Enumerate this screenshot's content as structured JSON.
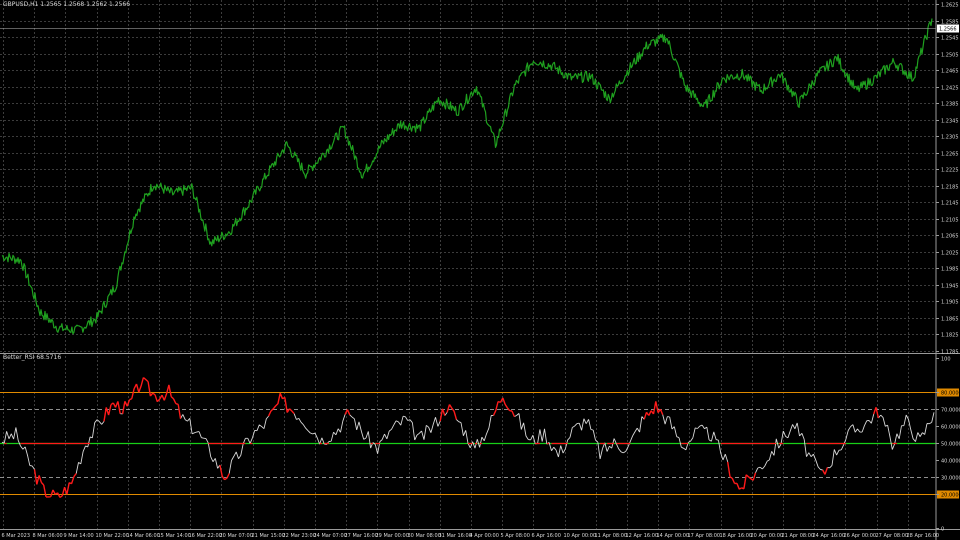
{
  "header": {
    "symbol_info": "GBPUSD,H1  1.2565 1.2568 1.2562 1.2566",
    "indicator_info": "Better_RSI 68.5716"
  },
  "colors": {
    "background": "#000000",
    "grid": "#3c3c3c",
    "axis_text": "#d8d8d8",
    "price_line": "#1fa01f",
    "rsi_line": "#d8d8d8",
    "rsi_extreme": "#ff1a1a",
    "midline": "#18d018",
    "level_extreme": "#e08a00",
    "level_inner": "#bdbdbd",
    "price_tag_bg": "#ffffff",
    "price_tag_text": "#000000"
  },
  "chart_data": [
    {
      "type": "line",
      "title": "GBPUSD,H1",
      "ylim": [
        1.1785,
        1.2625
      ],
      "y_ticks": [
        "1.2625",
        "1.2585",
        "1.2545",
        "1.2505",
        "1.2465",
        "1.2425",
        "1.2385",
        "1.2345",
        "1.2305",
        "1.2265",
        "1.2225",
        "1.2185",
        "1.2145",
        "1.2105",
        "1.2065",
        "1.2025",
        "1.1985",
        "1.1945",
        "1.1905",
        "1.1865",
        "1.1825",
        "1.1785"
      ],
      "current_price": "1.2566",
      "x": [
        "6 Mar 2023",
        "8 Mar 06:00",
        "9 Mar 14:00",
        "10 Mar 22:00",
        "14 Mar 06:00",
        "15 Mar 14:00",
        "16 Mar 22:00",
        "20 Mar 07:00",
        "21 Mar 15:00",
        "22 Mar 23:00",
        "24 Mar 07:00",
        "27 Mar 16:00",
        "29 Mar 00:00",
        "30 Mar 08:00",
        "31 Mar 16:00",
        "4 Apr 00:00",
        "5 Apr 08:00",
        "6 Apr 16:00",
        "10 Apr 00:00",
        "11 Apr 08:00",
        "12 Apr 16:00",
        "14 Apr 00:00",
        "17 Apr 08:00",
        "18 Apr 16:00",
        "20 Apr 00:00",
        "21 Apr 08:00",
        "24 Apr 16:00",
        "26 Apr 00:00",
        "27 Apr 08:00",
        "28 Apr 16:00"
      ],
      "series": [
        {
          "values": [
            1.2015,
            1.2005,
            1.188,
            1.184,
            1.1835,
            1.1865,
            1.1945,
            1.2115,
            1.219,
            1.2165,
            1.218,
            1.2045,
            1.2075,
            1.214,
            1.2215,
            1.2285,
            1.2215,
            1.2265,
            1.2325,
            1.221,
            1.2285,
            1.2335,
            1.2325,
            1.2395,
            1.2365,
            1.2425,
            1.2285,
            1.2425,
            1.249,
            1.2475,
            1.2445,
            1.245,
            1.2395,
            1.2465,
            1.2525,
            1.2545,
            1.2425,
            1.2375,
            1.2445,
            1.2455,
            1.2415,
            1.2455,
            1.2385,
            1.2455,
            1.2495,
            1.2415,
            1.2445,
            1.2485,
            1.2445,
            1.259
          ]
        }
      ]
    },
    {
      "type": "line",
      "title": "Better_RSI",
      "ylim": [
        0,
        100
      ],
      "y_ticks": [
        "100",
        "80.0000",
        "70.0000",
        "60.0000",
        "50.0000",
        "40.0000",
        "30.0000",
        "20.0000",
        "0"
      ],
      "levels": [
        80,
        70,
        50,
        30,
        20
      ],
      "series": [
        {
          "values": [
            52,
            55,
            38,
            22,
            18,
            26,
            50,
            62,
            73,
            70,
            86,
            78,
            80,
            64,
            57,
            45,
            30,
            43,
            55,
            62,
            75,
            69,
            61,
            52,
            57,
            68,
            55,
            47,
            58,
            64,
            52,
            60,
            72,
            61,
            46,
            60,
            79,
            66,
            51,
            56,
            43,
            57,
            64,
            44,
            50,
            47,
            63,
            72,
            62,
            48,
            57,
            55,
            40,
            23,
            31,
            41,
            52,
            61,
            43,
            31,
            46,
            56,
            61,
            69,
            50,
            63,
            51,
            68
          ]
        }
      ]
    }
  ]
}
